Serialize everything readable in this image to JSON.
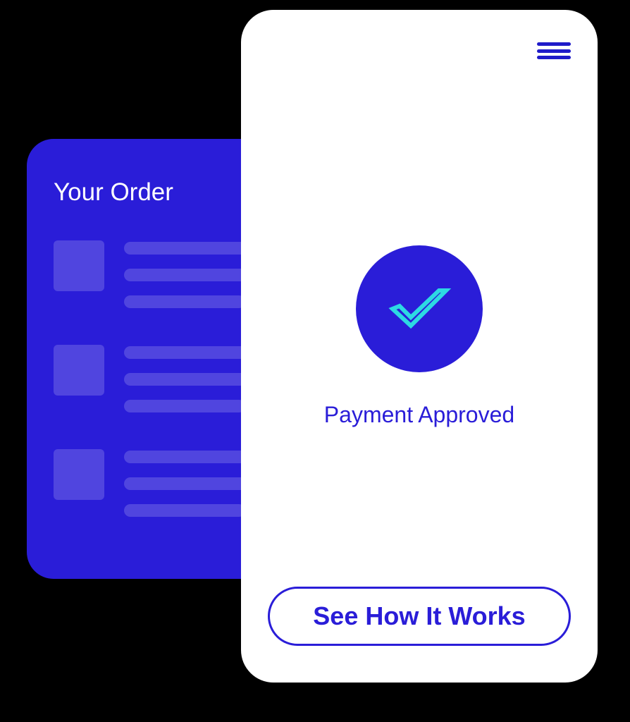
{
  "order": {
    "title": "Your Order",
    "items": [
      {
        "lines": 3
      },
      {
        "lines": 3
      },
      {
        "lines": 3
      }
    ]
  },
  "payment": {
    "status": "Payment Approved",
    "cta_label": "See How It Works"
  },
  "icons": {
    "menu": "hamburger-menu",
    "check": "checkmark"
  },
  "colors": {
    "primary": "#2a1dd8",
    "accent": "#2dd9e3"
  }
}
